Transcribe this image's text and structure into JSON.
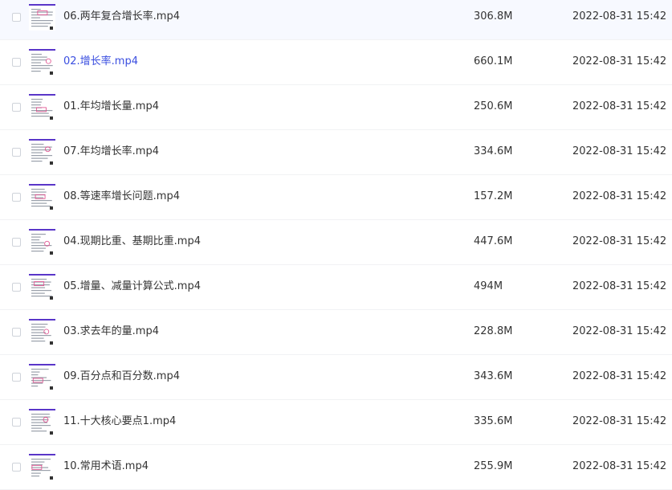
{
  "files": [
    {
      "name": "06.两年复合增长率.mp4",
      "size": "306.8M",
      "date": "2022-08-31 15:42",
      "thumb_icon": "video-thumbnail"
    },
    {
      "name": "02.增长率.mp4",
      "size": "660.1M",
      "date": "2022-08-31 15:42",
      "thumb_icon": "video-thumbnail",
      "highlighted": true
    },
    {
      "name": "01.年均增长量.mp4",
      "size": "250.6M",
      "date": "2022-08-31 15:42",
      "thumb_icon": "video-thumbnail"
    },
    {
      "name": "07.年均增长率.mp4",
      "size": "334.6M",
      "date": "2022-08-31 15:42",
      "thumb_icon": "video-thumbnail"
    },
    {
      "name": "08.等速率增长问题.mp4",
      "size": "157.2M",
      "date": "2022-08-31 15:42",
      "thumb_icon": "video-thumbnail"
    },
    {
      "name": "04.现期比重、基期比重.mp4",
      "size": "447.6M",
      "date": "2022-08-31 15:42",
      "thumb_icon": "video-thumbnail"
    },
    {
      "name": "05.增量、减量计算公式.mp4",
      "size": "494M",
      "date": "2022-08-31 15:42",
      "thumb_icon": "video-thumbnail"
    },
    {
      "name": "03.求去年的量.mp4",
      "size": "228.8M",
      "date": "2022-08-31 15:42",
      "thumb_icon": "video-thumbnail"
    },
    {
      "name": "09.百分点和百分数.mp4",
      "size": "343.6M",
      "date": "2022-08-31 15:42",
      "thumb_icon": "video-thumbnail"
    },
    {
      "name": "11.十大核心要点1.mp4",
      "size": "335.6M",
      "date": "2022-08-31 15:42",
      "thumb_icon": "video-thumbnail"
    },
    {
      "name": "10.常用术语.mp4",
      "size": "255.9M",
      "date": "2022-08-31 15:42",
      "thumb_icon": "video-thumbnail"
    }
  ],
  "colors": {
    "highlight_text": "#3a4ee0",
    "thumb_bar": "#5a36c9",
    "thumb_accent": "#e0488a",
    "divider": "#f1f2f4"
  }
}
